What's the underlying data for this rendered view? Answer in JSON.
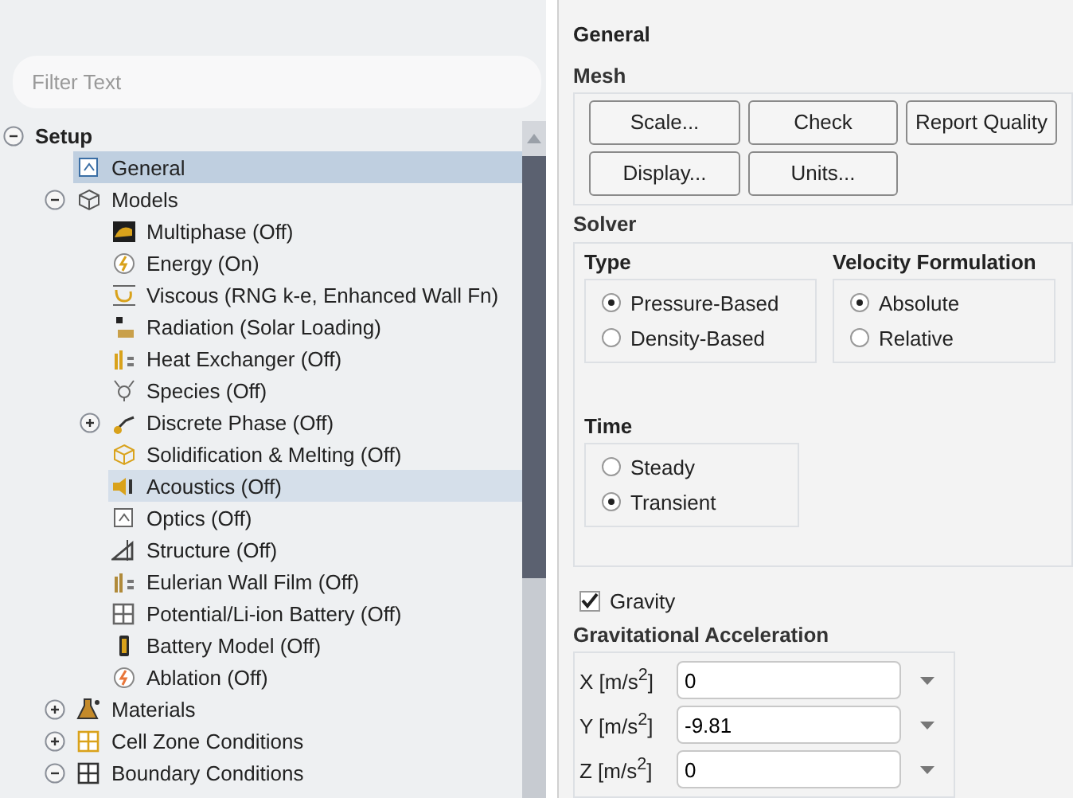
{
  "filter": {
    "placeholder": "Filter Text"
  },
  "tree": [
    {
      "label": "Setup",
      "expanded": true,
      "selected": false,
      "hovered": false,
      "children": [
        {
          "label": "General",
          "selected": true,
          "hovered": false
        },
        {
          "label": "Models",
          "expanded": true,
          "selected": false,
          "hovered": false,
          "children": [
            {
              "label": "Multiphase (Off)",
              "selected": false,
              "hovered": false
            },
            {
              "label": "Energy (On)",
              "selected": false,
              "hovered": false
            },
            {
              "label": "Viscous (RNG k-e, Enhanced Wall Fn)",
              "selected": false,
              "hovered": false
            },
            {
              "label": "Radiation (Solar Loading)",
              "selected": false,
              "hovered": false
            },
            {
              "label": "Heat Exchanger (Off)",
              "selected": false,
              "hovered": false
            },
            {
              "label": "Species (Off)",
              "selected": false,
              "hovered": false
            },
            {
              "label": "Discrete Phase (Off)",
              "expanded": false,
              "selected": false,
              "hovered": false
            },
            {
              "label": "Solidification & Melting (Off)",
              "selected": false,
              "hovered": false
            },
            {
              "label": "Acoustics (Off)",
              "selected": false,
              "hovered": true
            },
            {
              "label": "Optics (Off)",
              "selected": false,
              "hovered": false
            },
            {
              "label": "Structure (Off)",
              "selected": false,
              "hovered": false
            },
            {
              "label": "Eulerian Wall Film (Off)",
              "selected": false,
              "hovered": false
            },
            {
              "label": "Potential/Li-ion Battery (Off)",
              "selected": false,
              "hovered": false
            },
            {
              "label": "Battery Model (Off)",
              "selected": false,
              "hovered": false
            },
            {
              "label": "Ablation (Off)",
              "selected": false,
              "hovered": false
            }
          ]
        },
        {
          "label": "Materials",
          "expanded": false,
          "selected": false,
          "hovered": false
        },
        {
          "label": "Cell Zone Conditions",
          "expanded": false,
          "selected": false,
          "hovered": false
        },
        {
          "label": "Boundary Conditions",
          "expanded": true,
          "selected": false,
          "hovered": false
        }
      ]
    }
  ],
  "panel": {
    "title": "General",
    "mesh": {
      "title": "Mesh",
      "buttons": [
        "Scale...",
        "Check",
        "Report Quality",
        "Display...",
        "Units..."
      ]
    },
    "solver": {
      "title": "Solver",
      "type": {
        "title": "Type",
        "options": [
          {
            "label": "Pressure-Based",
            "selected": true
          },
          {
            "label": "Density-Based",
            "selected": false
          }
        ]
      },
      "velocity_formulation": {
        "title": "Velocity Formulation",
        "options": [
          {
            "label": "Absolute",
            "selected": true
          },
          {
            "label": "Relative",
            "selected": false
          }
        ]
      },
      "time": {
        "title": "Time",
        "options": [
          {
            "label": "Steady",
            "selected": false
          },
          {
            "label": "Transient",
            "selected": true
          }
        ]
      }
    },
    "gravity": {
      "label": "Gravity",
      "checked": true
    },
    "gravitational_acceleration": {
      "title": "Gravitational Acceleration",
      "fields": [
        {
          "label": "X [m/s$^{2}$]",
          "value": "0"
        },
        {
          "label": "Y [m/s$^{2}$]",
          "value": "-9.81"
        },
        {
          "label": "Z [m/s$^{2}$]",
          "value": "0"
        }
      ]
    }
  }
}
